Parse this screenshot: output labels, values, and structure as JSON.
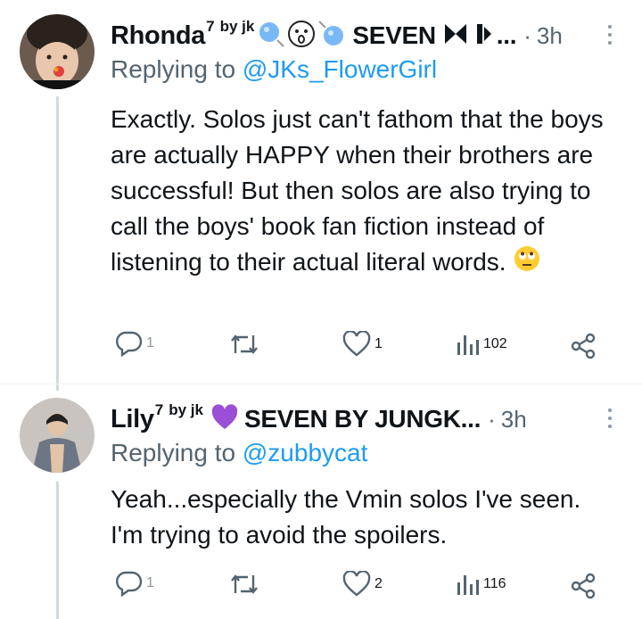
{
  "tweets": [
    {
      "author_name": "Rhonda",
      "author_sup": "7",
      "author_tag": "by jk",
      "author_suffix": "SEVEN",
      "time": "3h",
      "replying_label": "Replying to",
      "replying_handle": "@JKs_FlowerGirl",
      "text": "Exactly. Solos just can't fathom that the boys are actually HAPPY when their brothers are successful! But then solos are also trying to call the boys' book fan fiction instead of listening to their actual literal words.",
      "replies": "1",
      "likes": "1",
      "views": "102"
    },
    {
      "author_name": "Lily",
      "author_sup": "7",
      "author_tag": "by jk",
      "author_suffix": "SEVEN BY JUNGK...",
      "time": "3h",
      "replying_label": "Replying to",
      "replying_handle": "@zubbycat",
      "text": "Yeah...especially the Vmin solos I've seen. I'm trying to avoid the spoilers.",
      "replies": "1",
      "likes": "2",
      "views": "116"
    }
  ],
  "colors": {
    "accent": "#1d9bf0",
    "muted": "#536471",
    "text": "#0f1419",
    "line": "#cfd9de"
  },
  "icons": [
    "reply-icon",
    "retweet-icon",
    "like-icon",
    "views-icon",
    "share-icon",
    "more-icon",
    "eyeroll-emoji",
    "purple-heart-emoji"
  ]
}
